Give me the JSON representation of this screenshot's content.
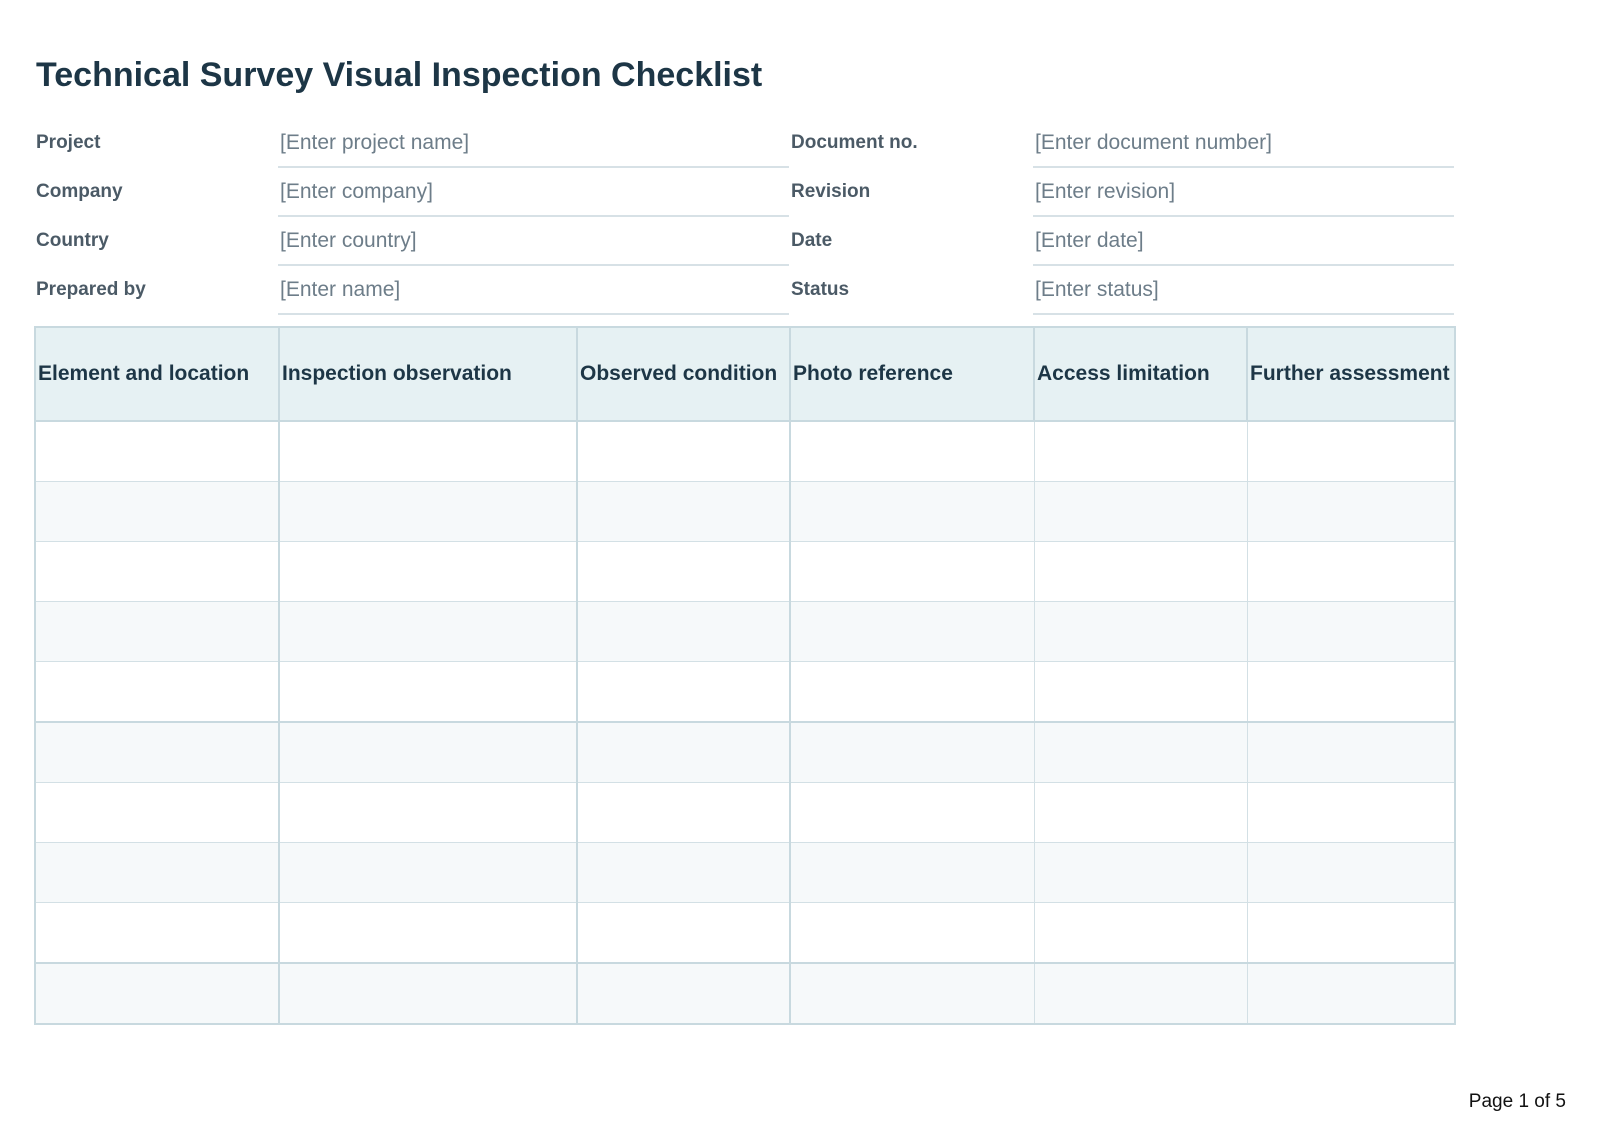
{
  "title": "Technical Survey Visual Inspection Checklist",
  "meta": [
    {
      "left_label": "Project",
      "left_value": "[Enter project name]",
      "right_label": "Document no.",
      "right_value": "[Enter document number]"
    },
    {
      "left_label": "Company",
      "left_value": "[Enter company]",
      "right_label": "Revision",
      "right_value": "[Enter revision]"
    },
    {
      "left_label": "Country",
      "left_value": "[Enter country]",
      "right_label": "Date",
      "right_value": "[Enter date]"
    },
    {
      "left_label": "Prepared by",
      "left_value": "[Enter name]",
      "right_label": "Status",
      "right_value": "[Enter status]"
    }
  ],
  "table": {
    "columns": [
      "Element and location",
      "Inspection observation",
      "Observed condition",
      "Photo reference",
      "Access limitation",
      "Further assessment"
    ],
    "rows": [
      [
        "",
        "",
        "",
        "",
        "",
        ""
      ],
      [
        "",
        "",
        "",
        "",
        "",
        ""
      ],
      [
        "",
        "",
        "",
        "",
        "",
        ""
      ],
      [
        "",
        "",
        "",
        "",
        "",
        ""
      ],
      [
        "",
        "",
        "",
        "",
        "",
        ""
      ],
      [
        "",
        "",
        "",
        "",
        "",
        ""
      ],
      [
        "",
        "",
        "",
        "",
        "",
        ""
      ],
      [
        "",
        "",
        "",
        "",
        "",
        ""
      ],
      [
        "",
        "",
        "",
        "",
        "",
        ""
      ],
      [
        "",
        "",
        "",
        "",
        "",
        ""
      ]
    ]
  },
  "footer": {
    "page_label": "Page 1 of 5"
  }
}
